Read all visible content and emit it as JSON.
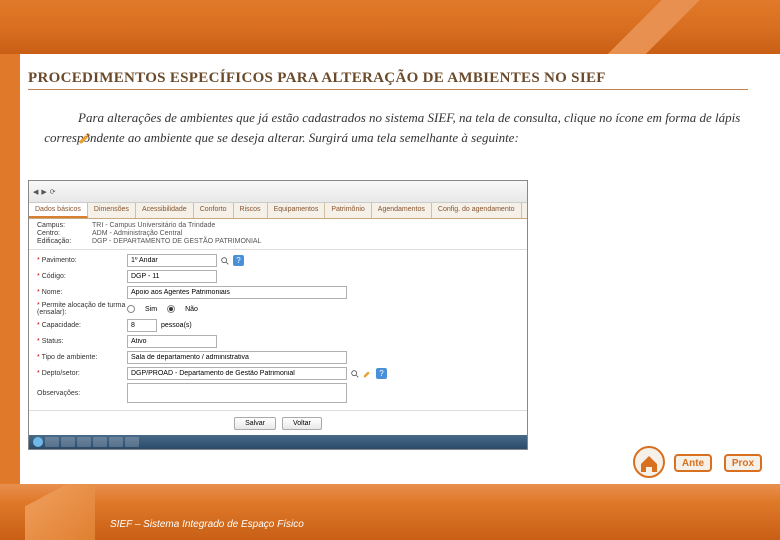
{
  "heading": "PROCEDIMENTOS ESPECÍFICOS PARA ALTERAÇÃO DE AMBIENTES NO SIEF",
  "instruction": {
    "part1": "Para alterações de ambientes que já estão cadastrados no sistema SIEF, na tela de consulta, clique no ícone em forma de lápis",
    "part2": "correspondente ao ambiente que se deseja alterar. Surgirá uma tela semelhante à seguinte:"
  },
  "screenshot": {
    "tabs": [
      "Dados básicos",
      "Dimensões",
      "Acessibilidade",
      "Conforto",
      "Riscos",
      "Equipamentos",
      "Patrimônio",
      "Agendamentos",
      "Config. do agendamento"
    ],
    "info": {
      "campus_label": "Campus:",
      "campus_value": "TRI - Campus Universitário da Trindade",
      "centro_label": "Centro:",
      "centro_value": "ADM - Administração Central",
      "edificacao_label": "Edificação:",
      "edificacao_value": "DGP - DEPARTAMENTO DE GESTÃO PATRIMONIAL"
    },
    "form": {
      "pavimento_label": "Pavimento:",
      "pavimento_value": "1º Andar",
      "codigo_label": "Código:",
      "codigo_value": "DGP - 11",
      "nome_label": "Nome:",
      "nome_value": "Apoio aos Agentes Patrimoniais",
      "permite_label": "Permite alocação de turma (ensalar):",
      "permite_sim": "Sim",
      "permite_nao": "Não",
      "capacidade_label": "Capacidade:",
      "capacidade_value": "8",
      "capacidade_unit": "pessoa(s)",
      "status_label": "Status:",
      "status_value": "Ativo",
      "tipo_label": "Tipo de ambiente:",
      "tipo_value": "Sala de departamento / administrativa",
      "deptosetor_label": "Depto/setor:",
      "deptosetor_value": "DGP/PROAD - Departamento de Gestão Patrimonial",
      "observacoes_label": "Observações:"
    },
    "buttons": {
      "salvar": "Salvar",
      "voltar": "Voltar"
    },
    "help_glyph": "?"
  },
  "nav": {
    "ante": "Ante",
    "prox": "Prox"
  },
  "footer": "SIEF – Sistema Integrado de Espaço Físico"
}
